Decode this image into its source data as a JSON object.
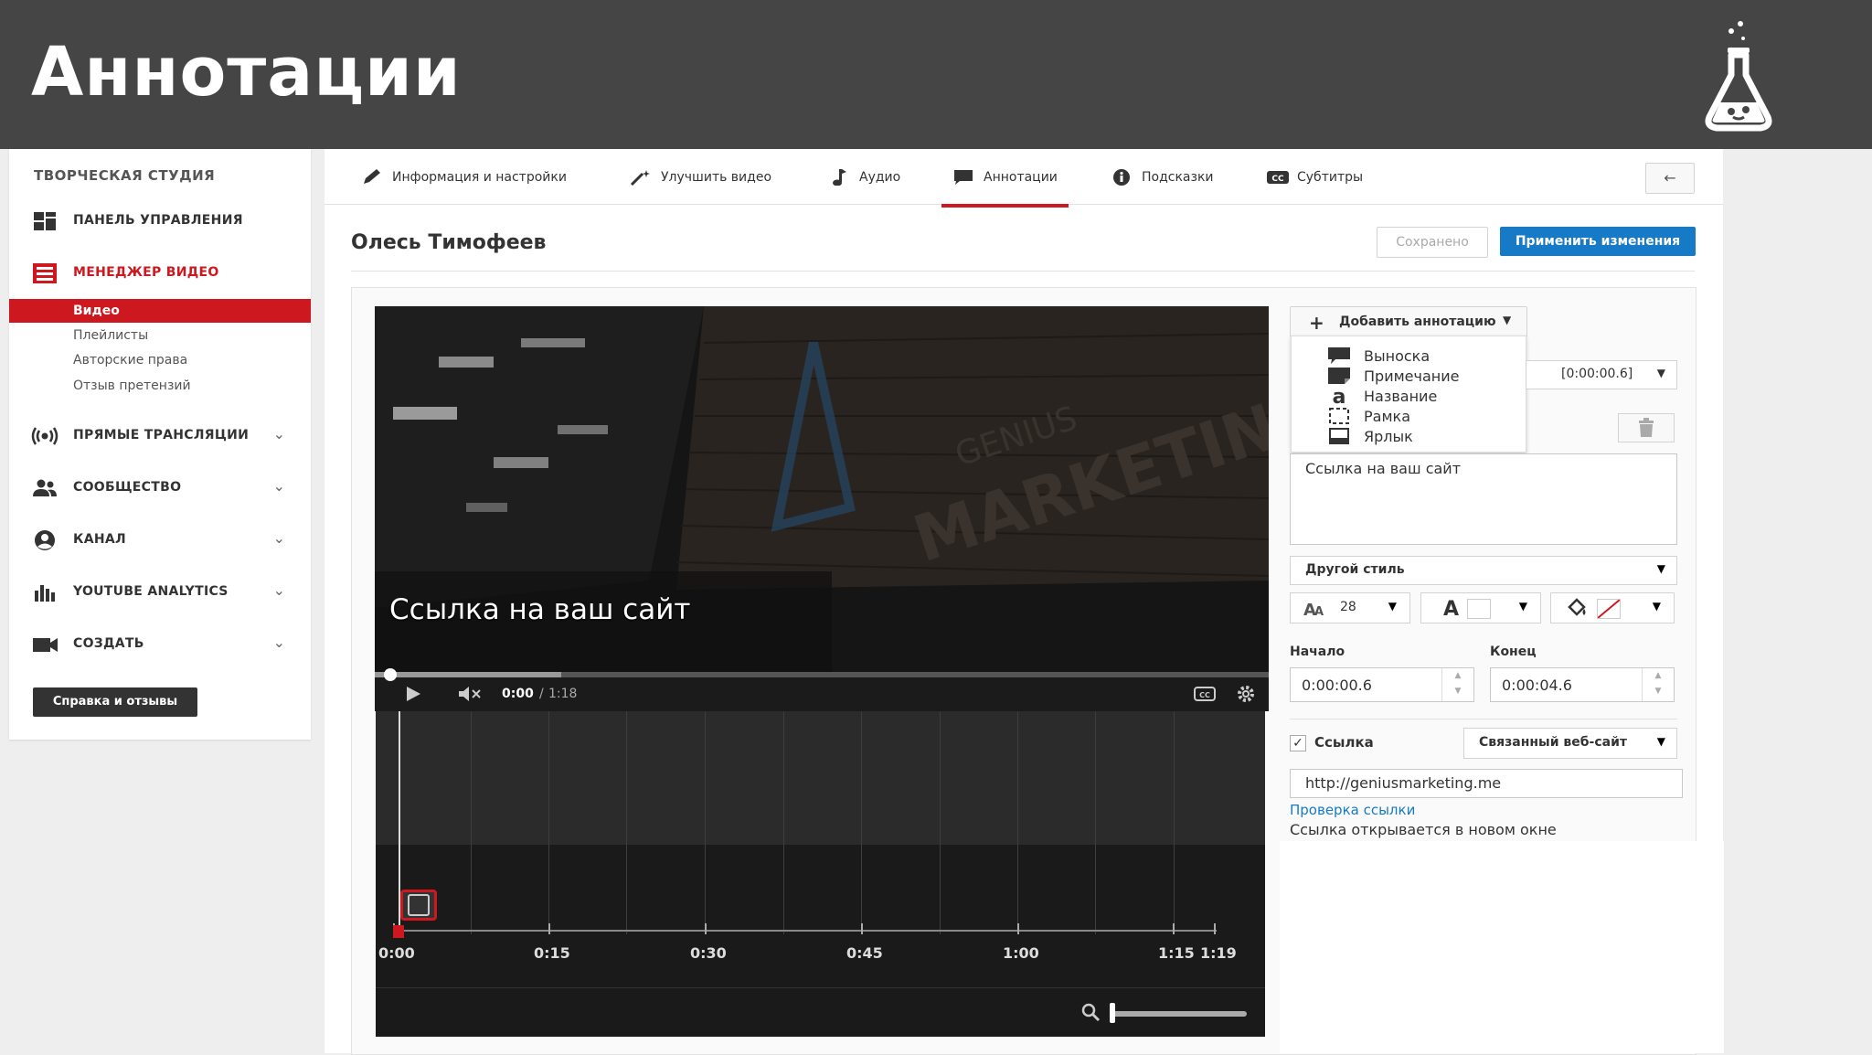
{
  "slide": {
    "title": "Аннотации"
  },
  "sidebar": {
    "header": "ТВОРЧЕСКАЯ СТУДИЯ",
    "items": [
      {
        "label": "ПАНЕЛЬ УПРАВЛЕНИЯ",
        "icon": "dashboard-icon"
      },
      {
        "label": "МЕНЕДЖЕР ВИДЕО",
        "icon": "video-manager-icon",
        "active": true
      },
      {
        "label": "ПРЯМЫЕ ТРАНСЛЯЦИИ",
        "icon": "broadcast-icon"
      },
      {
        "label": "СООБЩЕСТВО",
        "icon": "community-icon"
      },
      {
        "label": "КАНАЛ",
        "icon": "channel-icon"
      },
      {
        "label": "YOUTUBE ANALYTICS",
        "icon": "analytics-icon"
      },
      {
        "label": "СОЗДАТЬ",
        "icon": "create-icon"
      }
    ],
    "subitems": [
      "Видео",
      "Плейлисты",
      "Авторские права",
      "Отзыв претензий"
    ],
    "help_button": "Справка и отзывы"
  },
  "tabs": [
    {
      "label": "Информация и настройки",
      "icon": "pencil-icon"
    },
    {
      "label": "Улучшить видео",
      "icon": "magic-wand-icon"
    },
    {
      "label": "Аудио",
      "icon": "music-note-icon"
    },
    {
      "label": "Аннотации",
      "icon": "speech-bubble-icon",
      "active": true
    },
    {
      "label": "Подсказки",
      "icon": "info-icon"
    },
    {
      "label": "Субтитры",
      "icon": "cc-icon"
    }
  ],
  "header": {
    "owner": "Олесь Тимофеев",
    "saved_label": "Сохранено",
    "apply_label": "Применить изменения",
    "back_icon": "back-arrow-icon"
  },
  "player": {
    "overlay_text": "Ссылка на ваш сайт",
    "current_time": "0:00",
    "separator": "/",
    "duration": "1:18",
    "progress": 0.01
  },
  "timeline": {
    "labels": [
      "0:00",
      "0:15",
      "0:30",
      "0:45",
      "1:00",
      "1:15",
      "1:19"
    ]
  },
  "annotation_panel": {
    "add_button": "Добавить аннотацию",
    "menu": [
      {
        "label": "Выноска",
        "icon": "speech-bubble-icon"
      },
      {
        "label": "Примечание",
        "icon": "note-icon"
      },
      {
        "label": "Название",
        "icon": "title-icon"
      },
      {
        "label": "Рамка",
        "icon": "frame-icon"
      },
      {
        "label": "Ярлык",
        "icon": "label-icon"
      }
    ],
    "time_select": "[0:00:00.6]",
    "text_value": "Ссылка на ваш сайт",
    "style_select": "Другой стиль",
    "font_size": "28",
    "start_label": "Начало",
    "end_label": "Конец",
    "start_value": "0:00:00.6",
    "end_value": "0:00:04.6",
    "link_checked": true,
    "link_label": "Ссылка",
    "link_type": "Связанный веб-сайт",
    "url_value": "http://geniusmarketing.me",
    "check_link": "Проверка ссылки",
    "new_window": "Ссылка открывается в новом окне"
  },
  "colors": {
    "header_bg": "#454545",
    "accent_red": "#cc181e",
    "primary_blue": "#167ac6"
  }
}
